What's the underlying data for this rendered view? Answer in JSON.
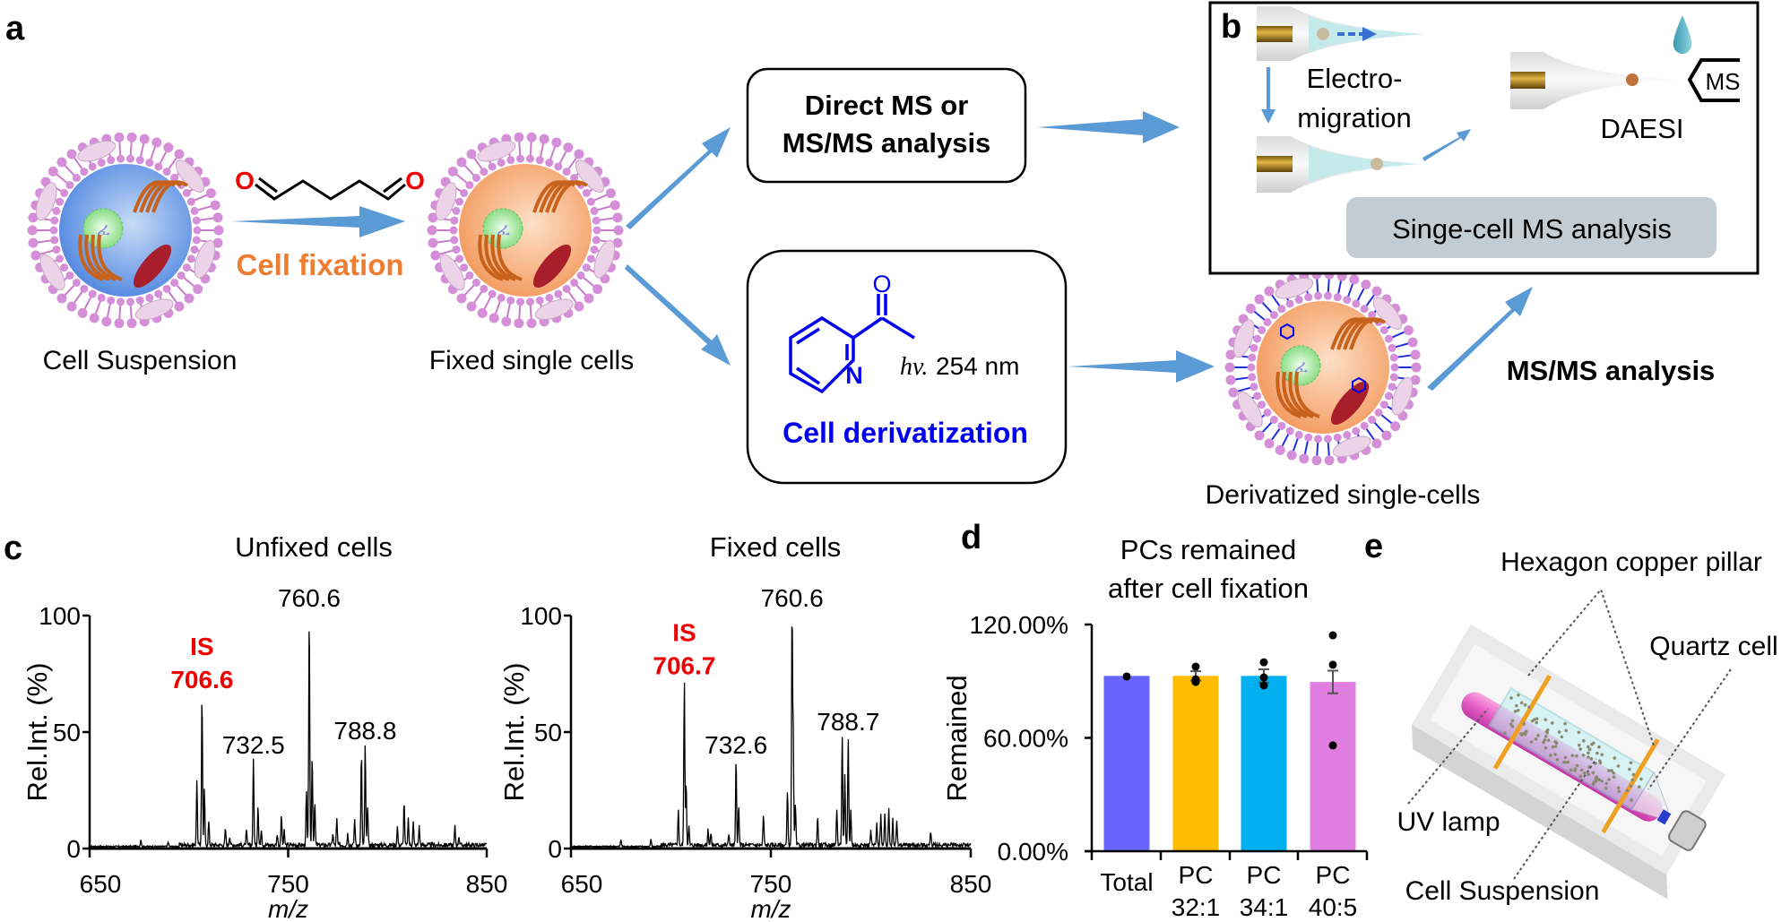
{
  "panels": {
    "a": "a",
    "b": "b",
    "c": "c",
    "d": "d",
    "e": "e"
  },
  "colors": {
    "arrow": "#5b9bd5",
    "fixation": "#ee7d31",
    "derivatization": "#0000ee",
    "is_label": "#ee0000",
    "oxygen": "#ee0000",
    "gray_box": "#c3cbd3"
  },
  "scheme": {
    "cell_suspension": "Cell Suspension",
    "cell_fixation": "Cell fixation",
    "fixed_cells": "Fixed single cells",
    "direct_line1": "Direct MS or",
    "direct_line2": "MS/MS analysis",
    "atom_o": "O",
    "atom_n": "N",
    "hv": "hv.",
    "wavelength": " 254 nm",
    "cell_derivatization": "Cell derivatization",
    "derivatized_cells": "Derivatized single-cells",
    "msms_analysis": "MS/MS analysis"
  },
  "panel_b": {
    "electro1": "Electro-",
    "electro2": "migration",
    "ms": "MS",
    "daesi": "DAESI",
    "singe_cell": "Singe-cell MS analysis"
  },
  "panel_e": {
    "hexagon": "Hexagon copper pillar",
    "quartz": "Quartz cell",
    "uv": "UV lamp",
    "suspension": "Cell Suspension"
  },
  "chart_data": [
    {
      "type": "line",
      "title": "Unfixed cells",
      "xlabel": "m/z",
      "ylabel": "Rel.Int. (%)",
      "xlim": [
        650,
        850
      ],
      "ylim": [
        0,
        100
      ],
      "xticks": [
        650,
        750,
        850
      ],
      "yticks": [
        0,
        50,
        100
      ],
      "peaks": [
        [
          675.8,
          3
        ],
        [
          689.6,
          2
        ],
        [
          704.0,
          28
        ],
        [
          706.6,
          65
        ],
        [
          707.8,
          24
        ],
        [
          710,
          10
        ],
        [
          718.4,
          7
        ],
        [
          720.5,
          4
        ],
        [
          729,
          6
        ],
        [
          732.5,
          37
        ],
        [
          734.8,
          17
        ],
        [
          736.5,
          7
        ],
        [
          744.5,
          5
        ],
        [
          746.6,
          13
        ],
        [
          748,
          6
        ],
        [
          759.2,
          23
        ],
        [
          760.6,
          100
        ],
        [
          762.1,
          39
        ],
        [
          763.4,
          18
        ],
        [
          772.5,
          5
        ],
        [
          774.5,
          11
        ],
        [
          780,
          5
        ],
        [
          783.5,
          11
        ],
        [
          786.9,
          40
        ],
        [
          788.8,
          43
        ],
        [
          790,
          17
        ],
        [
          805,
          8
        ],
        [
          808.4,
          19
        ],
        [
          810.5,
          11
        ],
        [
          813,
          10
        ],
        [
          816,
          8
        ],
        [
          834,
          8
        ],
        [
          836,
          4
        ]
      ],
      "labels": [
        {
          "text": "IS",
          "mz": 706.6,
          "y": 65,
          "highlight": true,
          "line": 2
        },
        {
          "text": "706.6",
          "mz": 706.6,
          "y": 65,
          "highlight": true,
          "line": 1
        },
        {
          "text": "732.5",
          "mz": 732.5,
          "y": 37
        },
        {
          "text": "760.6",
          "mz": 760.6,
          "y": 100
        },
        {
          "text": "788.8",
          "mz": 788.8,
          "y": 43
        }
      ]
    },
    {
      "type": "line",
      "title": "Fixed cells",
      "xlabel": "m/z",
      "ylabel": "Rel.Int. (%)",
      "xlim": [
        650,
        850
      ],
      "ylim": [
        0,
        100
      ],
      "xticks": [
        650,
        750,
        850
      ],
      "yticks": [
        0,
        50,
        100
      ],
      "peaks": [
        [
          675,
          3
        ],
        [
          690,
          3
        ],
        [
          703.7,
          15
        ],
        [
          706.7,
          71
        ],
        [
          707.6,
          28
        ],
        [
          709,
          8
        ],
        [
          718.6,
          7
        ],
        [
          720,
          5
        ],
        [
          729,
          5
        ],
        [
          732.6,
          37
        ],
        [
          733.9,
          17
        ],
        [
          746.3,
          13
        ],
        [
          758.3,
          23
        ],
        [
          760.6,
          100
        ],
        [
          761.2,
          47
        ],
        [
          762.3,
          17
        ],
        [
          773.4,
          12
        ],
        [
          783,
          16
        ],
        [
          785.7,
          48
        ],
        [
          787,
          30
        ],
        [
          788.7,
          47
        ],
        [
          790,
          15
        ],
        [
          800,
          6
        ],
        [
          803,
          9
        ],
        [
          805,
          14
        ],
        [
          807,
          13
        ],
        [
          809,
          15
        ],
        [
          811,
          12
        ],
        [
          813,
          10
        ],
        [
          830,
          6
        ]
      ],
      "labels": [
        {
          "text": "IS",
          "mz": 706.7,
          "y": 71,
          "highlight": true,
          "line": 2
        },
        {
          "text": "706.7",
          "mz": 706.7,
          "y": 71,
          "highlight": true,
          "line": 1
        },
        {
          "text": "732.6",
          "mz": 732.6,
          "y": 37
        },
        {
          "text": "760.6",
          "mz": 760.6,
          "y": 100
        },
        {
          "text": "788.7",
          "mz": 788.7,
          "y": 47
        }
      ]
    },
    {
      "type": "bar",
      "title_line1": "PCs remained",
      "title_line2": "after cell fixation",
      "ylabel": "Remained",
      "ylim": [
        0,
        120
      ],
      "yticks": [
        "0.00%",
        "60.00%",
        "120.00%"
      ],
      "ytick_values": [
        0,
        60,
        120
      ],
      "categories": [
        {
          "line1": "Total",
          "line2": ""
        },
        {
          "line1": "PC",
          "line2": "32:1"
        },
        {
          "line1": "PC",
          "line2": "34:1"
        },
        {
          "line1": "PC",
          "line2": "40:5"
        }
      ],
      "values": [
        92.8,
        92.8,
        92.8,
        89.6
      ],
      "error": [
        0,
        2.5,
        3.5,
        6
      ],
      "points": [
        [
          92.5
        ],
        [
          97.7,
          91,
          89.6
        ],
        [
          100,
          92,
          87.8
        ],
        [
          114.3,
          98.7,
          56
        ]
      ],
      "bar_colors": [
        "#6666ff",
        "#ffbb00",
        "#00b0f0",
        "#e07de0"
      ]
    }
  ]
}
